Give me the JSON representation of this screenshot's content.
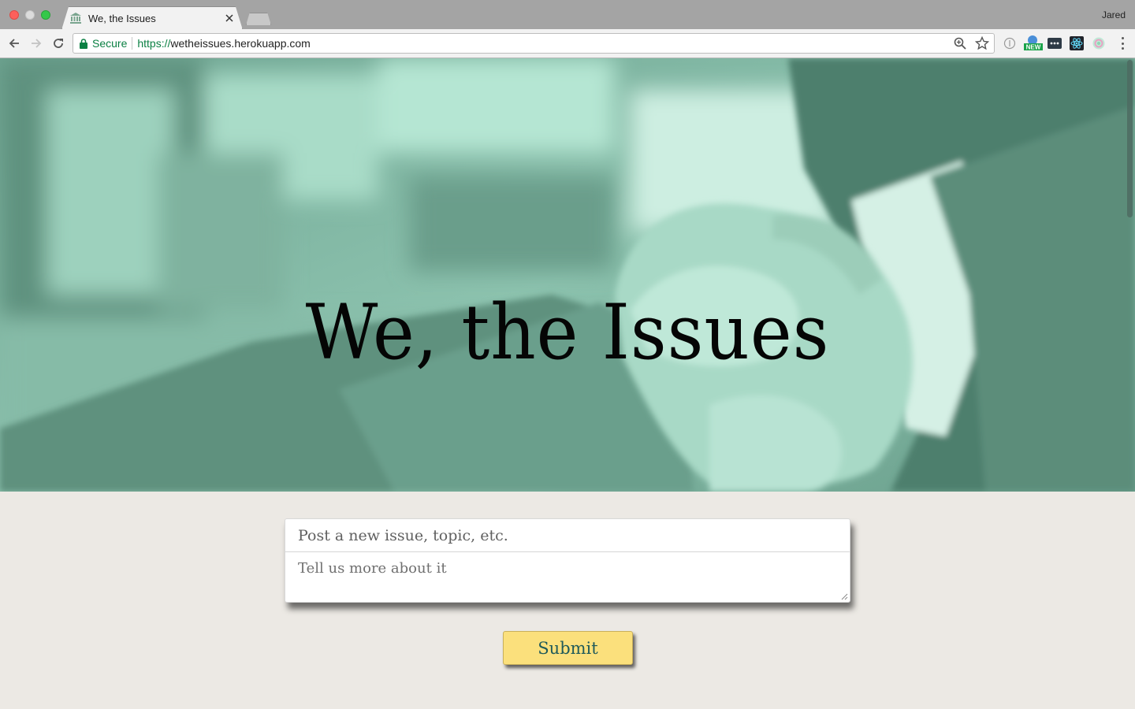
{
  "browser": {
    "tab_title": "We, the Issues",
    "profile_name": "Jared",
    "security_label": "Secure",
    "url_scheme": "https://",
    "url_host": "wetheissues.herokuapp.com",
    "extensions": [
      "extension-circle-icon",
      "new-badge-extension-icon",
      "dots-extension-icon",
      "react-extension-icon",
      "color-extension-icon"
    ],
    "new_badge_text": "NEW"
  },
  "hero": {
    "title": "We, the Issues",
    "background": "handshake-photo",
    "tint_color": "#7fb4a2"
  },
  "form": {
    "title_placeholder": "Post a new issue, topic, etc.",
    "body_placeholder": "Tell us more about it",
    "submit_label": "Submit"
  },
  "colors": {
    "page_bg": "#ece9e4",
    "submit_bg": "#fbe07c",
    "submit_text": "#1f5a5a",
    "secure_green": "#0b8043"
  }
}
